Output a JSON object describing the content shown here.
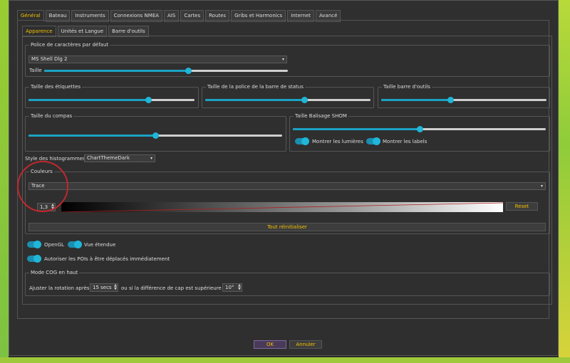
{
  "tabs": [
    "Général",
    "Bateau",
    "Instruments",
    "Connexions NMEA",
    "AIS",
    "Cartes",
    "Routes",
    "Gribs et Harmonics",
    "Internet",
    "Avancé"
  ],
  "subtabs": [
    "Apparence",
    "Unités et Langue",
    "Barre d'outils"
  ],
  "font_group": {
    "title": "Police de caractères par défaut",
    "font_value": "MS Shell Dlg 2",
    "size_label": "Taille",
    "size_level": 0.59
  },
  "label_size": {
    "title": "Taille des étiquettes",
    "level": 0.72
  },
  "statusbar_font": {
    "title": "Taille de la police de la barre de status",
    "level": 0.6
  },
  "toolbar_size": {
    "title": "Taille barre d'outils",
    "level": 0.42
  },
  "compass": {
    "title": "Taille du compas",
    "level": 0.5
  },
  "shom": {
    "title": "Taille Balisage SHOM",
    "level": 0.5,
    "lights_label": "Montrer les lumières",
    "labels_label": "Montrer les labels"
  },
  "histogram": {
    "label": "Style des histogrammes",
    "value": "ChartThemeDark"
  },
  "colors": {
    "title": "Couleurs",
    "selected": "Trace",
    "spin_value": "1,3",
    "reset_label": "Reset",
    "reset_all_label": "Tout réinitialiser"
  },
  "toggles": {
    "opengl": "OpenGL",
    "extended_view": "Vue étendue",
    "move_pois": "Autoriser les POIs à être déplacés immédiatement"
  },
  "cog": {
    "title": "Mode COG en haut",
    "prefix": "Ajuster la rotation après",
    "secs_value": "15 secs",
    "middle": "ou si la différence de cap est supérieure à",
    "deg_value": "10°"
  },
  "footer": {
    "ok": "OK",
    "cancel": "Annuler"
  },
  "accent_color": "#f0c000",
  "slider_color": "#1aa3c4"
}
